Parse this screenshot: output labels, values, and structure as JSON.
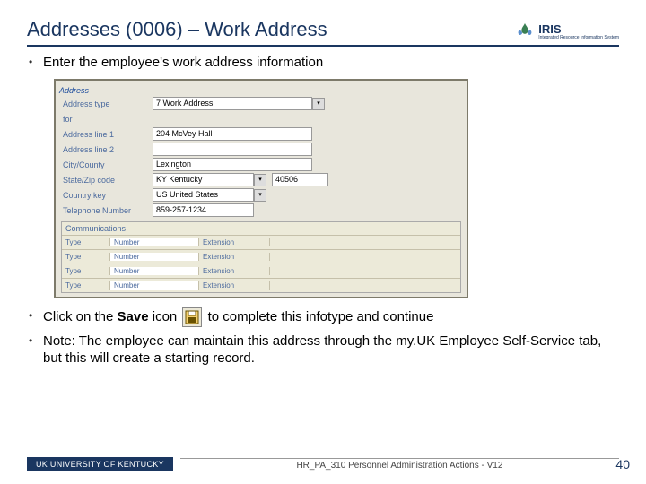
{
  "header": {
    "title": "Addresses (0006) – Work Address",
    "iris_label": "IRIS",
    "iris_sub": "Integrated Resource Information System"
  },
  "bullets": {
    "b1": "Enter the employee's work address information",
    "b2a": "Click on the ",
    "b2b": "Save",
    "b2c": " icon ",
    "b2d": " to complete this infotype and continue",
    "b3": "Note:  The employee can maintain this address through the my.UK Employee Self-Service tab, but this will create a starting record."
  },
  "form": {
    "section_address": "Address",
    "labels": {
      "addr_type": "Address type",
      "for": "for",
      "line1": "Address line 1",
      "line2": "Address line 2",
      "city": "City/County",
      "state": "State/Zip code",
      "country": "Country key",
      "phone": "Telephone Number",
      "comm": "Communications"
    },
    "values": {
      "addr_type": "7 Work Address",
      "line1": "204 McVey Hall",
      "city": "Lexington",
      "state": "KY Kentucky",
      "zip": "40506",
      "country": "US United States",
      "phone": "859-257-1234"
    },
    "comm_rows": {
      "type": "Type",
      "number": "Number",
      "extension": "Extension"
    }
  },
  "footer": {
    "uk": "UK  UNIVERSITY OF KENTUCKY",
    "doc": "HR_PA_310 Personnel Administration Actions - V12",
    "page": "40"
  }
}
